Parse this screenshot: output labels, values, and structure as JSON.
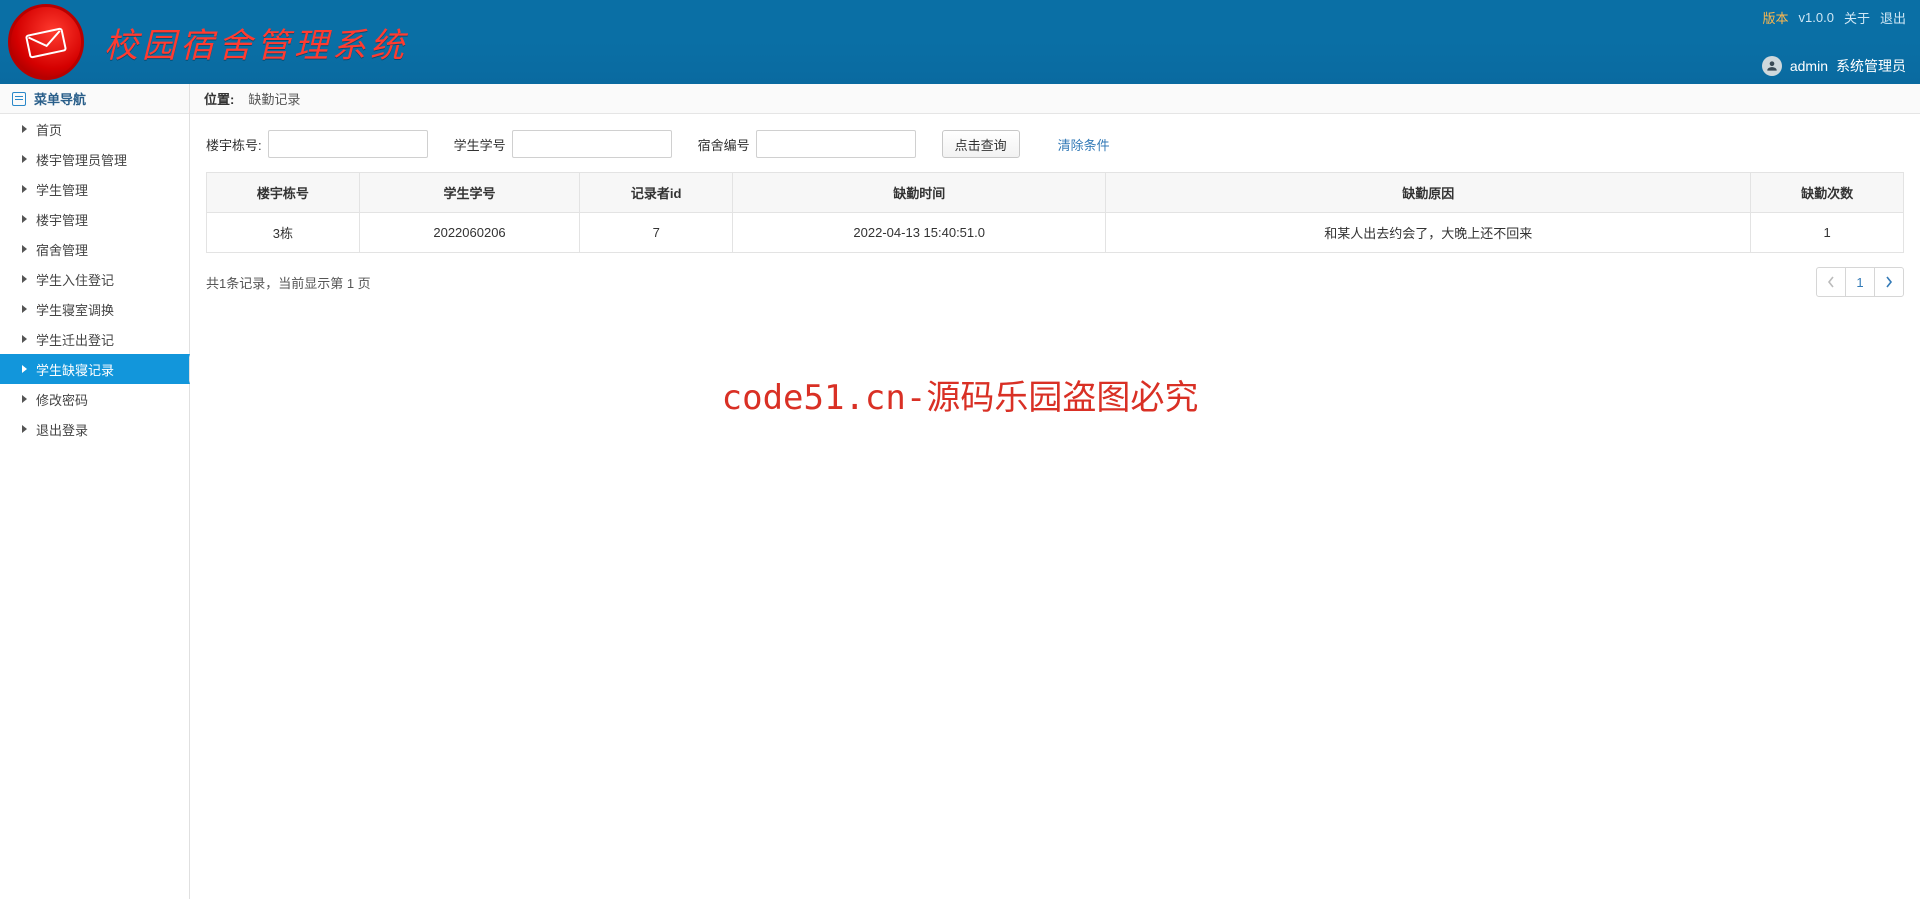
{
  "banner": {
    "app_title": "校园宿舍管理系统",
    "version_label": "版本",
    "version_value": "v1.0.0",
    "about_label": "关于",
    "logout_label": "退出",
    "username": "admin",
    "role": "系统管理员"
  },
  "sidebar": {
    "header": "菜单导航",
    "items": [
      {
        "label": "首页"
      },
      {
        "label": "楼宇管理员管理"
      },
      {
        "label": "学生管理"
      },
      {
        "label": "楼宇管理"
      },
      {
        "label": "宿舍管理"
      },
      {
        "label": "学生入住登记"
      },
      {
        "label": "学生寝室调换"
      },
      {
        "label": "学生迁出登记"
      },
      {
        "label": "学生缺寝记录",
        "active": true
      },
      {
        "label": "修改密码"
      },
      {
        "label": "退出登录"
      }
    ]
  },
  "breadcrumb": {
    "label": "位置:",
    "page": "缺勤记录"
  },
  "filters": {
    "building_label": "楼宇栋号:",
    "building_value": "",
    "student_label": "学生学号",
    "student_value": "",
    "dorm_label": "宿舍编号",
    "dorm_value": "",
    "search_btn": "点击查询",
    "clear_btn": "清除条件"
  },
  "table": {
    "headers": [
      "楼宇栋号",
      "学生学号",
      "记录者id",
      "缺勤时间",
      "缺勤原因",
      "缺勤次数"
    ],
    "rows": [
      {
        "c0": "3栋",
        "c1": "2022060206",
        "c2": "7",
        "c3": "2022-04-13 15:40:51.0",
        "c4": "和某人出去约会了，大晚上还不回来",
        "c5": "1"
      }
    ]
  },
  "pager": {
    "summary": "共1条记录，当前显示第 1 页",
    "current": "1"
  },
  "watermark": "code51.cn-源码乐园盗图必究"
}
